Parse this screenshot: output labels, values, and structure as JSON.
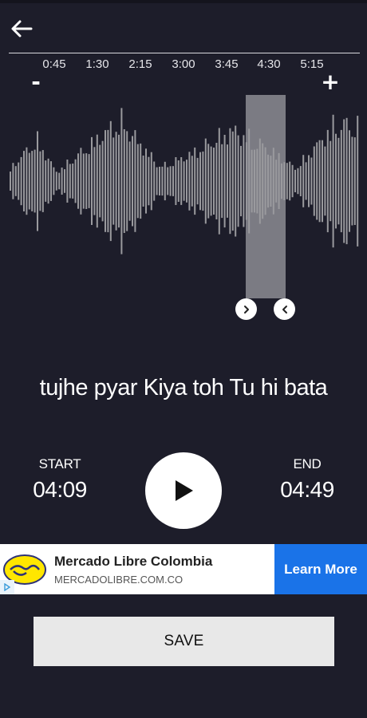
{
  "colors": {
    "background": "#1d1d2a",
    "waveform": "#9a9a9e",
    "selection": "#c8c8cc",
    "ad_button": "#1a73e8",
    "save_button": "#e8e8e8"
  },
  "icons": {
    "back": "arrow-left-icon",
    "handle_left": "chevron-right-icon",
    "handle_right": "chevron-left-icon",
    "play": "play-icon",
    "ad_logo": "handshake-icon",
    "ad_choices": "adchoices-icon"
  },
  "timeline": {
    "ticks": [
      "0:45",
      "1:30",
      "2:15",
      "3:00",
      "3:45",
      "4:30",
      "5:15"
    ],
    "zoom_out_label": "-",
    "zoom_in_label": "+"
  },
  "lyric": "tujhe pyar Kiya toh Tu hi bata",
  "start": {
    "label": "START",
    "value": "04:09"
  },
  "end": {
    "label": "END",
    "value": "04:49"
  },
  "ad": {
    "title": "Mercado Libre Colombia",
    "url": "MERCADOLIBRE.COM.CO",
    "cta": "Learn More"
  },
  "save_label": "SAVE"
}
